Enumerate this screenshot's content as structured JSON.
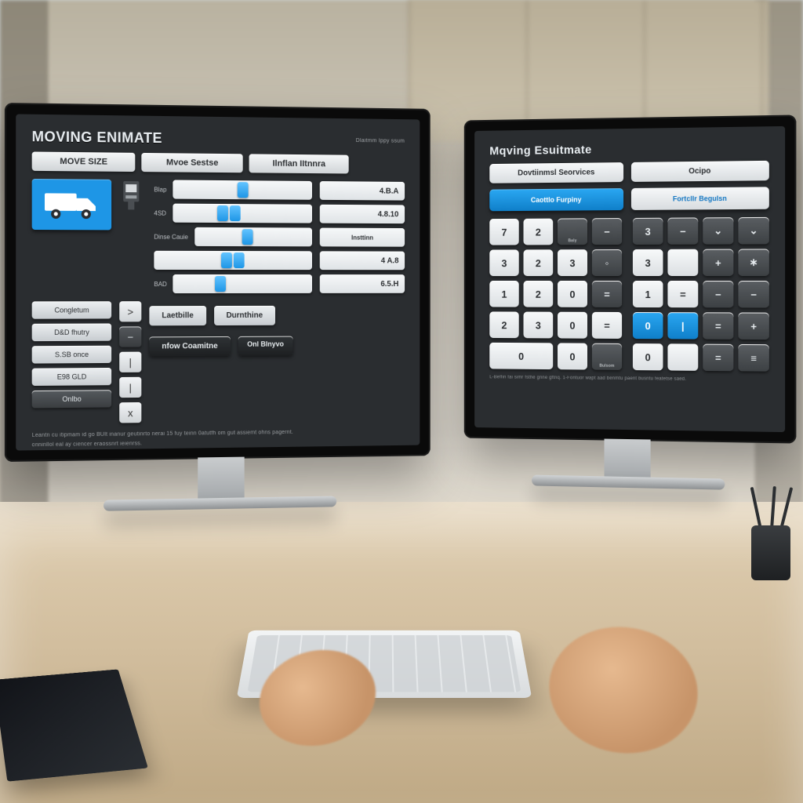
{
  "left": {
    "title": "MOVING ENIMATE",
    "corner": "Dlaitmm Ippy ssum",
    "tabs": [
      "MOVE SIZE",
      "Mvoe Sestse",
      "Ilnflan IItnnra"
    ],
    "sidebar": [
      "Congletum",
      "D&D fhutry",
      "S.SB once",
      "E98 GLD",
      "Onlbo"
    ],
    "mini": [
      ">",
      "−",
      "|",
      "|",
      "x"
    ],
    "sliders": [
      {
        "label": "Blap",
        "pos": 46
      },
      {
        "label": "4SD",
        "pos": 32
      },
      {
        "label": "Dinse Cauie",
        "pos": 40
      },
      {
        "label": "",
        "pos": 42
      },
      {
        "label": "BAD",
        "pos": 30
      }
    ],
    "prices": [
      "4.B.A",
      "4.8.10",
      "Insttinn",
      "4 A.8",
      "6.5.H"
    ],
    "bottom": {
      "left": "Laetbille",
      "right": "Durnthine",
      "dark": "nfow Coamitne",
      "chip": "Onl Blnyvo"
    },
    "footnote1": "Leantn cu itipmam id go BUlt inanur geutinrto nerai 15 fuy teinn 0atutfh om gut assiemt ohns pagernt.",
    "footnote2": "onninllol eal ay ciencer eraossnrt ieienrss."
  },
  "right": {
    "title": "Mqving Esuitmate",
    "tabs": [
      "Dovtiinmsl Seorvices",
      "Ocipo"
    ],
    "actions": [
      "Caottlo Furpiny",
      "Fortcllr Begulsn"
    ],
    "padA": [
      {
        "t": "7"
      },
      {
        "t": "2"
      },
      {
        "t": "Baly",
        "d": true,
        "sub": 1
      },
      {
        "t": "−",
        "d": true
      },
      {
        "t": "3"
      },
      {
        "t": "2"
      },
      {
        "t": "3"
      },
      {
        "t": "◦",
        "d": true
      },
      {
        "t": "1"
      },
      {
        "t": "2"
      },
      {
        "t": "0"
      },
      {
        "t": "=",
        "d": true
      },
      {
        "t": "2"
      },
      {
        "t": "3"
      },
      {
        "t": "0"
      },
      {
        "t": "="
      },
      {
        "t": "0",
        "w": 2
      },
      {
        "t": "0"
      },
      {
        "t": "Bulsom",
        "d": true,
        "sub": 1
      }
    ],
    "padB": [
      {
        "t": "3",
        "d": true
      },
      {
        "t": "−",
        "d": true
      },
      {
        "t": "⌄",
        "d": true
      },
      {
        "t": "⌄",
        "d": true
      },
      {
        "t": "3"
      },
      {
        "t": " "
      },
      {
        "t": "+",
        "d": true
      },
      {
        "t": "∗",
        "d": true
      },
      {
        "t": "1"
      },
      {
        "t": "="
      },
      {
        "t": "−",
        "d": true
      },
      {
        "t": "−",
        "d": true
      },
      {
        "t": "0",
        "b": true
      },
      {
        "t": "|",
        "b": true
      },
      {
        "t": "=",
        "d": true
      },
      {
        "t": "+",
        "d": true
      },
      {
        "t": "0"
      },
      {
        "t": " "
      },
      {
        "t": "=",
        "d": true
      },
      {
        "t": "≡",
        "d": true
      }
    ],
    "foot": "L-Beffin fai simr fsthe gnne gftnq. 1-Fontuor wapt aad benmtu paent bŭsntu featetse saed."
  }
}
